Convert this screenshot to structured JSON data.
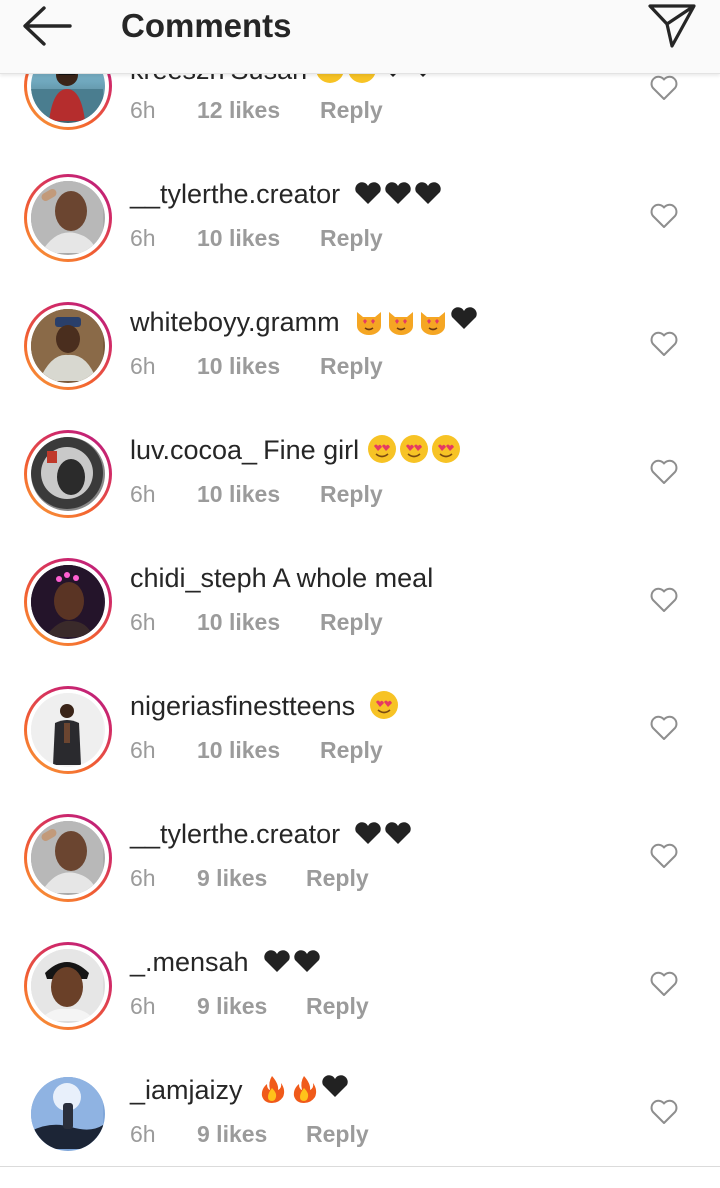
{
  "header": {
    "title": "Comments",
    "back_icon": "arrow-left-icon",
    "send_icon": "paper-plane-icon"
  },
  "colors": {
    "ring_start": "#f9a13a",
    "ring_end": "#b41b86",
    "meta_gray": "#9b9b9b",
    "text": "#262626"
  },
  "comments": [
    {
      "username": "kreeszh",
      "text": "Susan",
      "time": "6h",
      "likes": "12 likes",
      "reply": "Reply",
      "emojis": [
        "blush",
        "blush",
        "black-heart",
        "black-heart"
      ]
    },
    {
      "username": "__tylerthe.creator",
      "text": "",
      "time": "6h",
      "likes": "10 likes",
      "reply": "Reply",
      "emojis": [
        "black-heart",
        "black-heart",
        "black-heart"
      ]
    },
    {
      "username": "whiteboyy.gramm",
      "text": "",
      "time": "6h",
      "likes": "10 likes",
      "reply": "Reply",
      "emojis": [
        "heart-eyes-cat",
        "heart-eyes-cat",
        "heart-eyes-cat",
        "black-heart"
      ]
    },
    {
      "username": "luv.cocoa_",
      "text": "Fine girl",
      "time": "6h",
      "likes": "10 likes",
      "reply": "Reply",
      "emojis": [
        "heart-eyes",
        "heart-eyes",
        "heart-eyes"
      ]
    },
    {
      "username": "chidi_steph",
      "text": "A whole meal",
      "time": "6h",
      "likes": "10 likes",
      "reply": "Reply",
      "emojis": []
    },
    {
      "username": "nigeriasfinestteens",
      "text": "",
      "time": "6h",
      "likes": "10 likes",
      "reply": "Reply",
      "emojis": [
        "heart-eyes"
      ]
    },
    {
      "username": "__tylerthe.creator",
      "text": "",
      "time": "6h",
      "likes": "9 likes",
      "reply": "Reply",
      "emojis": [
        "black-heart",
        "black-heart"
      ]
    },
    {
      "username": "_.mensah",
      "text": "",
      "time": "6h",
      "likes": "9 likes",
      "reply": "Reply",
      "emojis": [
        "black-heart",
        "black-heart"
      ]
    },
    {
      "username": "_iamjaizy",
      "text": "",
      "time": "6h",
      "likes": "9 likes",
      "reply": "Reply",
      "emojis": [
        "fire",
        "fire",
        "black-heart"
      ]
    }
  ]
}
